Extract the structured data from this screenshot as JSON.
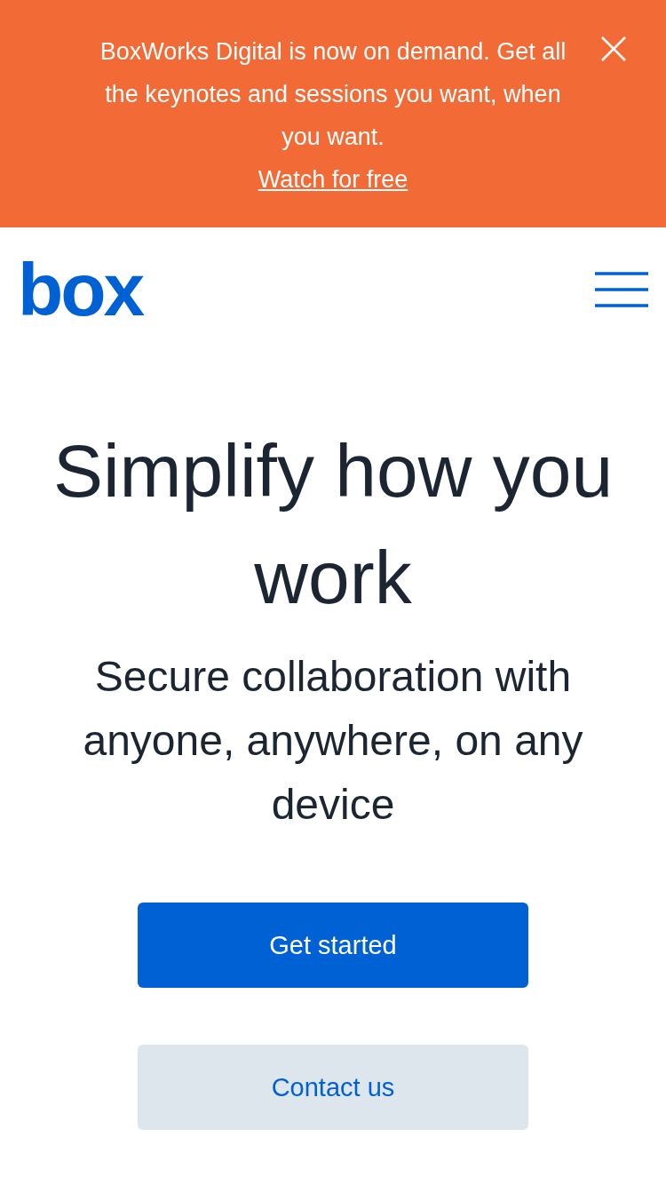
{
  "banner": {
    "message": "BoxWorks Digital is now on demand. Get all the keynotes and sessions you want, when you want.",
    "link": "Watch for free"
  },
  "header": {
    "logo": "box"
  },
  "hero": {
    "title": "Simplify how you work",
    "subtitle": "Secure collaboration with anyone, anywhere, on any device"
  },
  "buttons": [
    {
      "label": "Get started",
      "kind": "primary"
    },
    {
      "label": "Contact us",
      "kind": "secondary"
    }
  ]
}
